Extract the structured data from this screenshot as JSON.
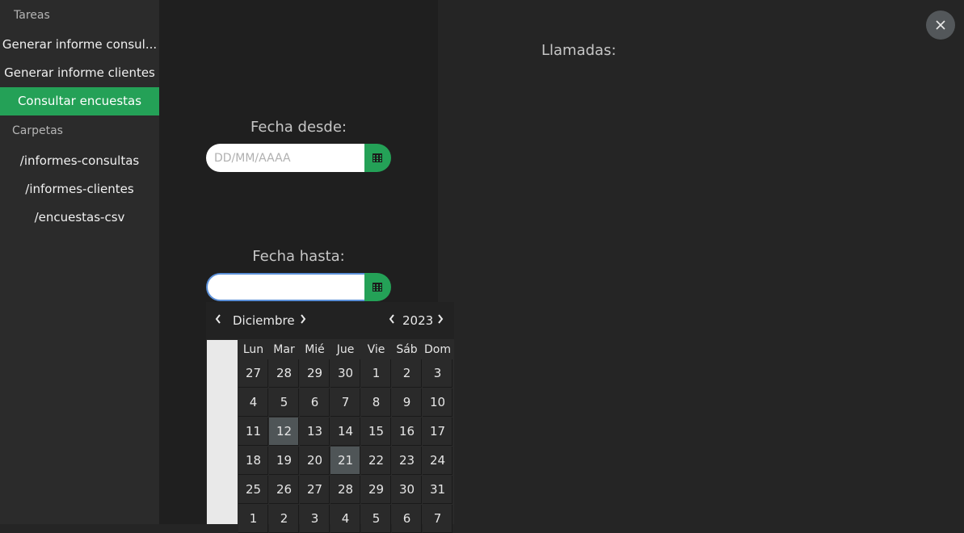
{
  "sidebar": {
    "tasks_header": "Tareas",
    "items": [
      {
        "label": "Generar informe consul..."
      },
      {
        "label": "Generar informe clientes"
      },
      {
        "label": "Consultar encuestas"
      }
    ],
    "folders_header": "Carpetas",
    "folders": [
      {
        "label": "/informes-consultas"
      },
      {
        "label": "/informes-clientes"
      },
      {
        "label": "/encuestas-csv"
      }
    ]
  },
  "form": {
    "from_label": "Fecha desde:",
    "from_placeholder": "DD/MM/AAAA",
    "from_value": "",
    "to_label": "Fecha hasta:",
    "to_value": ""
  },
  "calendar": {
    "month": "Diciembre",
    "year": "2023",
    "weekdays": [
      "Lun",
      "Mar",
      "Mié",
      "Jue",
      "Vie",
      "Sáb",
      "Dom"
    ],
    "weeks": [
      [
        "27",
        "28",
        "29",
        "30",
        "1",
        "2",
        "3"
      ],
      [
        "4",
        "5",
        "6",
        "7",
        "8",
        "9",
        "10"
      ],
      [
        "11",
        "12",
        "13",
        "14",
        "15",
        "16",
        "17"
      ],
      [
        "18",
        "19",
        "20",
        "21",
        "22",
        "23",
        "24"
      ],
      [
        "25",
        "26",
        "27",
        "28",
        "29",
        "30",
        "31"
      ],
      [
        "1",
        "2",
        "3",
        "4",
        "5",
        "6",
        "7"
      ]
    ],
    "highlighted": [
      "12",
      "21"
    ],
    "icons": {
      "prev": "chevron-left-icon",
      "next": "chevron-right-icon"
    }
  },
  "right": {
    "title": "Llamadas:"
  },
  "icons": {
    "calendar": "calendar-icon",
    "close": "close-icon"
  },
  "colors": {
    "accent": "#24a157",
    "background": "#252525",
    "sidebar": "#2b2b2b",
    "panel": "#1f1f1f"
  }
}
